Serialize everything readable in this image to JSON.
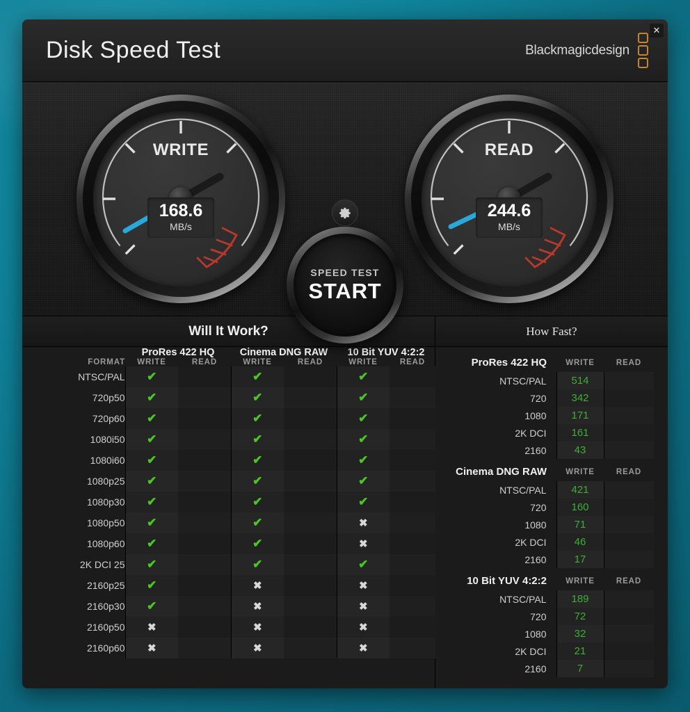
{
  "window": {
    "title": "Disk Speed Test",
    "brand": "Blackmagicdesign",
    "close_label": "✕",
    "logo_icon": "blackmagic-logo-icon"
  },
  "gauges": {
    "write": {
      "label": "WRITE",
      "value": "168.6",
      "unit": "MB/s",
      "needle_color": "#29a8dc"
    },
    "read": {
      "label": "READ",
      "value": "244.6",
      "unit": "MB/s",
      "needle_color": "#29a8dc"
    }
  },
  "controls": {
    "gear_icon": "gear-icon",
    "start_small": "SPEED TEST",
    "start_big": "START"
  },
  "will_it_work": {
    "title": "Will It Work?",
    "format_header": "FORMAT",
    "codecs": [
      "ProRes 422 HQ",
      "Cinema DNG RAW",
      "10 Bit YUV 4:2:2"
    ],
    "sub_headers": [
      "WRITE",
      "READ"
    ],
    "ok_mark": "✔",
    "no_mark": "✖",
    "rows": [
      {
        "format": "NTSC/PAL",
        "cells": [
          true,
          null,
          true,
          null,
          true,
          null
        ]
      },
      {
        "format": "720p50",
        "cells": [
          true,
          null,
          true,
          null,
          true,
          null
        ]
      },
      {
        "format": "720p60",
        "cells": [
          true,
          null,
          true,
          null,
          true,
          null
        ]
      },
      {
        "format": "1080i50",
        "cells": [
          true,
          null,
          true,
          null,
          true,
          null
        ]
      },
      {
        "format": "1080i60",
        "cells": [
          true,
          null,
          true,
          null,
          true,
          null
        ]
      },
      {
        "format": "1080p25",
        "cells": [
          true,
          null,
          true,
          null,
          true,
          null
        ]
      },
      {
        "format": "1080p30",
        "cells": [
          true,
          null,
          true,
          null,
          true,
          null
        ]
      },
      {
        "format": "1080p50",
        "cells": [
          true,
          null,
          true,
          null,
          false,
          null
        ]
      },
      {
        "format": "1080p60",
        "cells": [
          true,
          null,
          true,
          null,
          false,
          null
        ]
      },
      {
        "format": "2K DCI 25",
        "cells": [
          true,
          null,
          true,
          null,
          true,
          null
        ]
      },
      {
        "format": "2160p25",
        "cells": [
          true,
          null,
          false,
          null,
          false,
          null
        ]
      },
      {
        "format": "2160p30",
        "cells": [
          true,
          null,
          false,
          null,
          false,
          null
        ]
      },
      {
        "format": "2160p50",
        "cells": [
          false,
          null,
          false,
          null,
          false,
          null
        ]
      },
      {
        "format": "2160p60",
        "cells": [
          false,
          null,
          false,
          null,
          false,
          null
        ]
      }
    ]
  },
  "how_fast": {
    "title": "How Fast?",
    "col_write": "WRITE",
    "col_read": "READ",
    "groups": [
      {
        "name": "ProRes 422 HQ",
        "rows": [
          {
            "label": "NTSC/PAL",
            "write": "514",
            "read": ""
          },
          {
            "label": "720",
            "write": "342",
            "read": ""
          },
          {
            "label": "1080",
            "write": "171",
            "read": ""
          },
          {
            "label": "2K DCI",
            "write": "161",
            "read": ""
          },
          {
            "label": "2160",
            "write": "43",
            "read": ""
          }
        ]
      },
      {
        "name": "Cinema DNG RAW",
        "rows": [
          {
            "label": "NTSC/PAL",
            "write": "421",
            "read": ""
          },
          {
            "label": "720",
            "write": "160",
            "read": ""
          },
          {
            "label": "1080",
            "write": "71",
            "read": ""
          },
          {
            "label": "2K DCI",
            "write": "46",
            "read": ""
          },
          {
            "label": "2160",
            "write": "17",
            "read": ""
          }
        ]
      },
      {
        "name": "10 Bit YUV 4:2:2",
        "rows": [
          {
            "label": "NTSC/PAL",
            "write": "189",
            "read": ""
          },
          {
            "label": "720",
            "write": "72",
            "read": ""
          },
          {
            "label": "1080",
            "write": "32",
            "read": ""
          },
          {
            "label": "2K DCI",
            "write": "21",
            "read": ""
          },
          {
            "label": "2160",
            "write": "7",
            "read": ""
          }
        ]
      }
    ]
  },
  "colors": {
    "ok_green": "#4cc626",
    "value_green": "#3fae36",
    "needle_blue": "#29a8dc",
    "redzone": "#b8392c",
    "brand_orange": "#c8842c",
    "desktop_teal": "#10839a"
  }
}
